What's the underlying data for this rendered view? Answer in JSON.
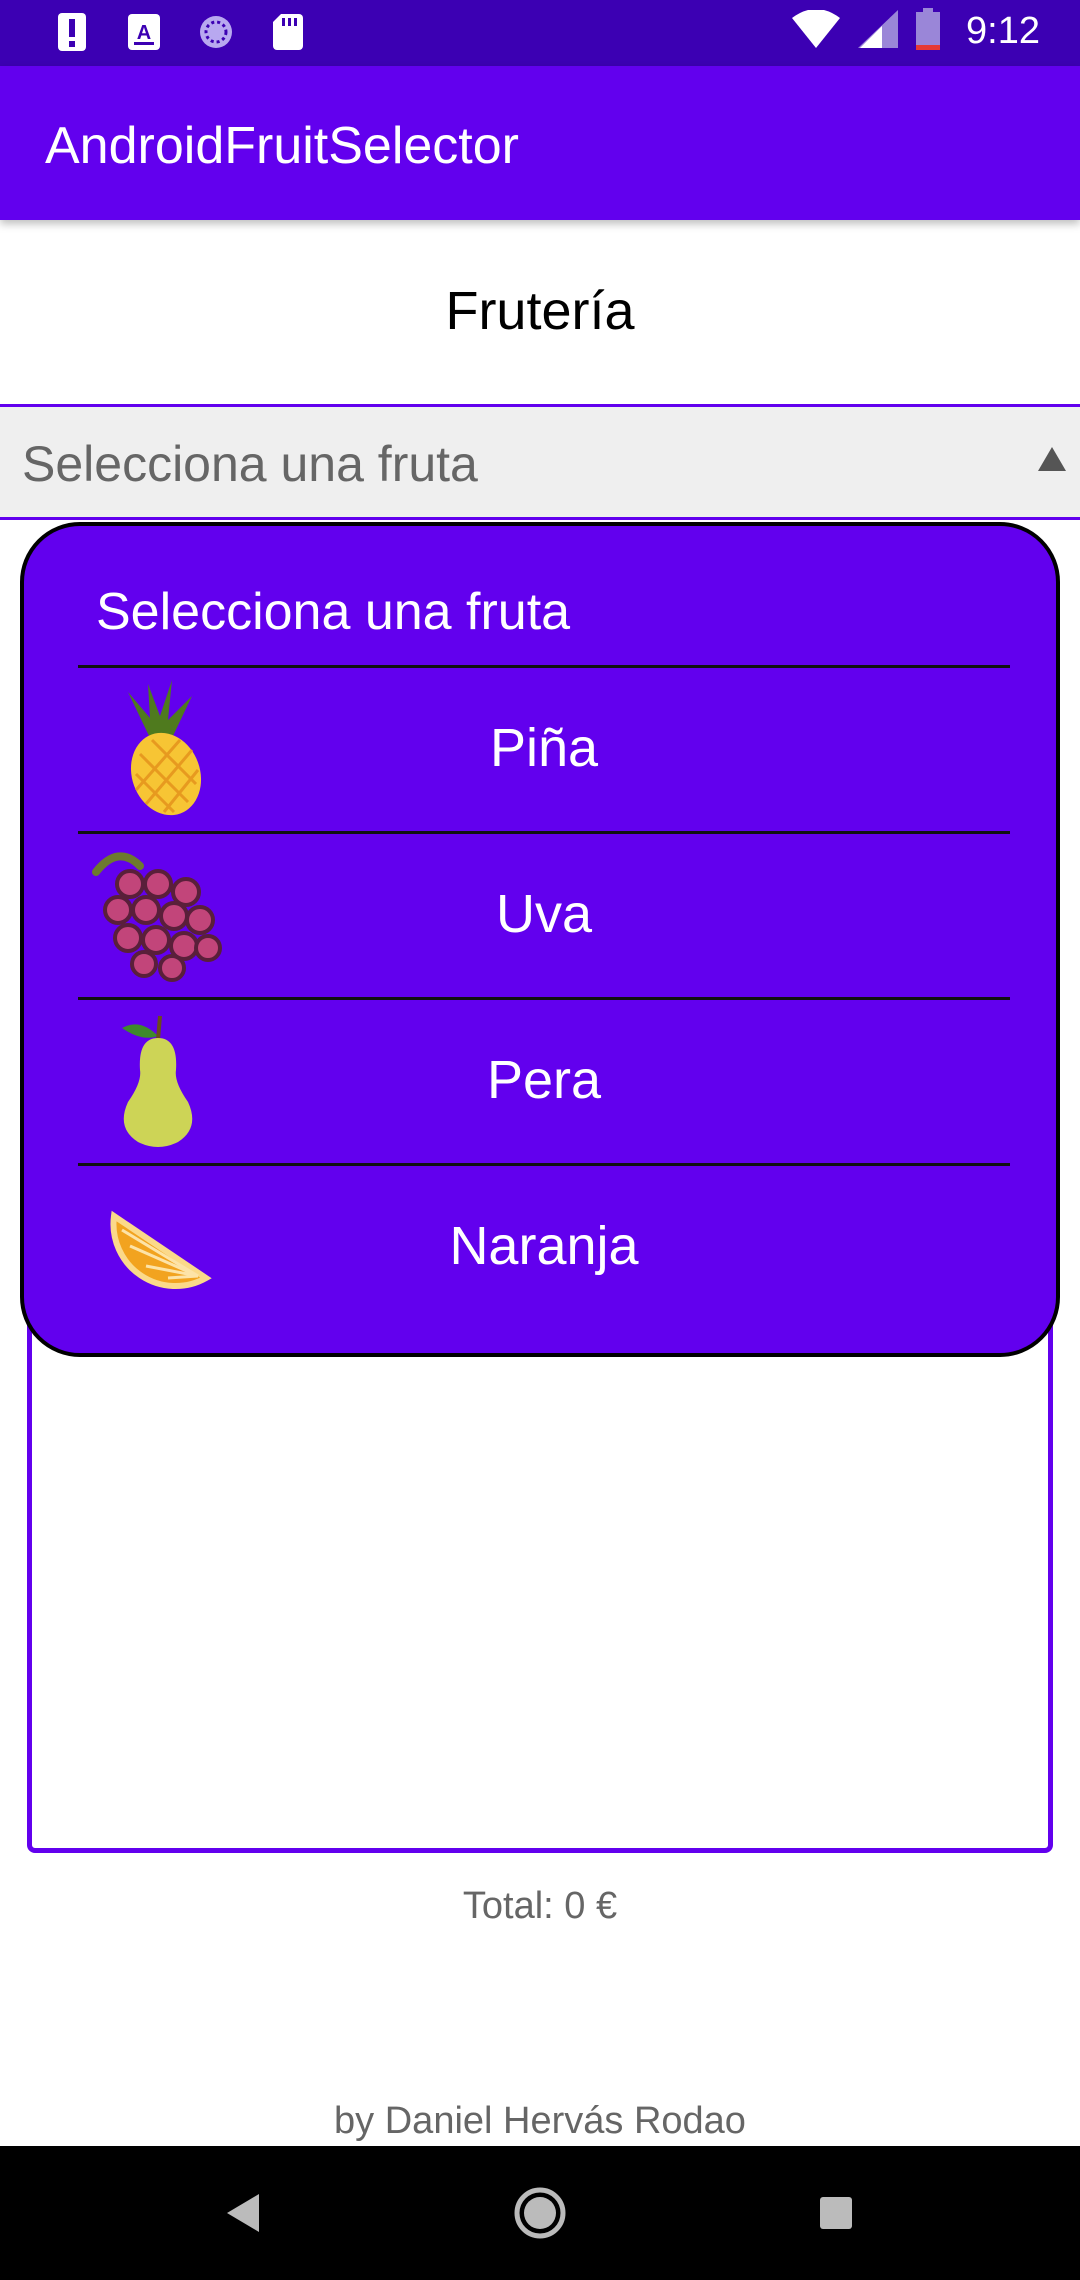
{
  "status_bar": {
    "time": "9:12",
    "left_icons": [
      "alert-icon",
      "font-icon",
      "sync-icon",
      "sd-card-icon"
    ],
    "right_icons": [
      "wifi-icon",
      "signal-icon",
      "battery-icon"
    ]
  },
  "app_bar": {
    "title": "AndroidFruitSelector"
  },
  "main": {
    "heading": "Frutería",
    "spinner_placeholder": "Selecciona una fruta",
    "total_label": "Total: 0 €",
    "author": "by Daniel Hervás Rodao"
  },
  "dropdown": {
    "header": "Selecciona una fruta",
    "options": [
      {
        "label": "Piña",
        "icon": "pineapple-icon"
      },
      {
        "label": "Uva",
        "icon": "grapes-icon"
      },
      {
        "label": "Pera",
        "icon": "pear-icon"
      },
      {
        "label": "Naranja",
        "icon": "orange-slice-icon"
      }
    ]
  },
  "nav_bar": {
    "buttons": [
      "back-icon",
      "home-icon",
      "recents-icon"
    ]
  },
  "colors": {
    "primary": "#6200ee",
    "status_bar": "#3c00b3",
    "spinner_bg": "#efefef"
  }
}
